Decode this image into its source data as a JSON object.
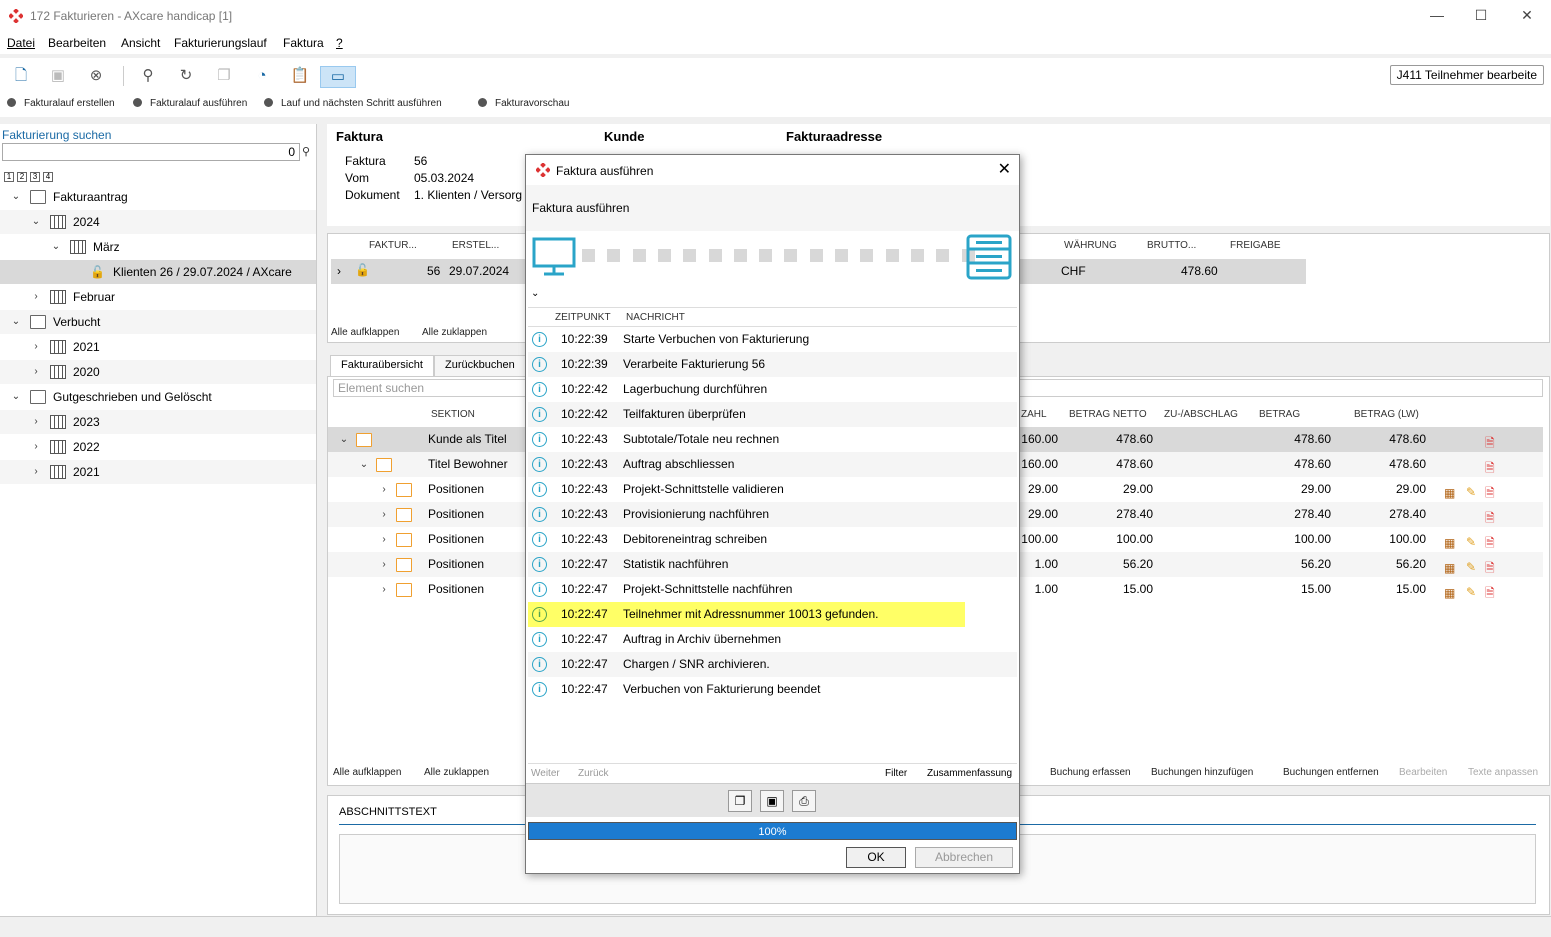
{
  "window": {
    "title": "172 Fakturieren - AXcare handicap [1]",
    "min": "—",
    "max": "☐",
    "close": "✕"
  },
  "menu": [
    "Datei",
    "Bearbeiten",
    "Ansicht",
    "Fakturierungslauf",
    "Faktura",
    "?"
  ],
  "top_button": "J411 Teilnehmer bearbeite",
  "actions": [
    "Fakturalauf erstellen",
    "Fakturalauf ausführen",
    "Lauf und nächsten Schritt ausführen",
    "Fakturavorschau"
  ],
  "left": {
    "search_label": "Fakturierung suchen",
    "search_value": "0",
    "levels": [
      "1",
      "2",
      "3",
      "4"
    ],
    "tree": [
      {
        "label": "Fakturaantrag",
        "chev": "⌄",
        "icon": "folder"
      },
      {
        "label": "2024",
        "chev": "⌄",
        "icon": "cal"
      },
      {
        "label": "März",
        "chev": "⌄",
        "icon": "cal"
      },
      {
        "label": "Klienten 26 / 29.07.2024 / AXcare",
        "chev": "",
        "icon": "lock"
      },
      {
        "label": "Februar",
        "chev": "›",
        "icon": "cal"
      },
      {
        "label": "Verbucht",
        "chev": "⌄",
        "icon": "folder"
      },
      {
        "label": "2021",
        "chev": "›",
        "icon": "cal"
      },
      {
        "label": "2020",
        "chev": "›",
        "icon": "cal"
      },
      {
        "label": "Gutgeschrieben und Gelöscht",
        "chev": "⌄",
        "icon": "folder"
      },
      {
        "label": "2023",
        "chev": "›",
        "icon": "cal"
      },
      {
        "label": "2022",
        "chev": "›",
        "icon": "cal"
      },
      {
        "label": "2021",
        "chev": "›",
        "icon": "cal"
      }
    ]
  },
  "header": {
    "faktura": "Faktura",
    "kunde": "Kunde",
    "adresse": "Fakturaadresse",
    "faktura_lbl": "Faktura",
    "faktura_val": "56",
    "vom_lbl": "Vom",
    "vom_val": "05.03.2024",
    "dok_lbl": "Dokument",
    "dok_val": "1. Klienten / Versorg"
  },
  "grid1": {
    "cols": [
      "FAKTUR...",
      "ERSTEL...",
      "WÄHRUNG",
      "BRUTTO...",
      "FREIGABE"
    ],
    "row": {
      "nr": "56",
      "date": "29.07.2024",
      "cur": "CHF",
      "brutto": "478.60"
    },
    "expand": "Alle aufklappen",
    "collapse": "Alle zuklappen"
  },
  "tabs": [
    "Fakturaübersicht",
    "Zurückbuchen"
  ],
  "grid2": {
    "search_placeholder": "Element suchen",
    "cols": [
      "SEKTION",
      "ZAHL",
      "BETRAG NETTO",
      "ZU-/ABSCHLAG",
      "BETRAG",
      "BETRAG (LW)"
    ],
    "rows": [
      {
        "label": "Kunde als Titel",
        "zahl": "160.00",
        "netto": "478.60",
        "betrag": "478.60",
        "lw": "478.60"
      },
      {
        "label": "Titel Bewohner",
        "zahl": "160.00",
        "netto": "478.60",
        "betrag": "478.60",
        "lw": "478.60"
      },
      {
        "label": "Positionen",
        "zahl": "29.00",
        "netto": "29.00",
        "betrag": "29.00",
        "lw": "29.00"
      },
      {
        "label": "Positionen",
        "zahl": "29.00",
        "netto": "278.40",
        "betrag": "278.40",
        "lw": "278.40"
      },
      {
        "label": "Positionen",
        "zahl": "100.00",
        "netto": "100.00",
        "betrag": "100.00",
        "lw": "100.00"
      },
      {
        "label": "Positionen",
        "zahl": "1.00",
        "netto": "56.20",
        "betrag": "56.20",
        "lw": "56.20"
      },
      {
        "label": "Positionen",
        "zahl": "1.00",
        "netto": "15.00",
        "betrag": "15.00",
        "lw": "15.00"
      }
    ],
    "footer": [
      "Alle aufklappen",
      "Alle zuklappen",
      "Buchung erfassen",
      "Buchungen hinzufügen",
      "Buchungen entfernen",
      "Bearbeiten",
      "Texte anpassen"
    ]
  },
  "abschnitt": "ABSCHNITTSTEXT",
  "dialog": {
    "title": "Faktura ausführen",
    "subtitle": "Faktura ausführen",
    "cols": [
      "ZEITPUNKT",
      "NACHRICHT"
    ],
    "log": [
      {
        "t": "10:22:39",
        "m": "Starte Verbuchen von Fakturierung"
      },
      {
        "t": "10:22:39",
        "m": "Verarbeite Fakturierung 56"
      },
      {
        "t": "10:22:42",
        "m": "Lagerbuchung durchführen"
      },
      {
        "t": "10:22:42",
        "m": "Teilfakturen überprüfen"
      },
      {
        "t": "10:22:43",
        "m": "Subtotale/Totale neu rechnen"
      },
      {
        "t": "10:22:43",
        "m": "Auftrag abschliessen"
      },
      {
        "t": "10:22:43",
        "m": "Projekt-Schnittstelle validieren"
      },
      {
        "t": "10:22:43",
        "m": "Provisionierung nachführen"
      },
      {
        "t": "10:22:43",
        "m": "Debitoreneintrag schreiben"
      },
      {
        "t": "10:22:47",
        "m": "Statistik nachführen"
      },
      {
        "t": "10:22:47",
        "m": "Projekt-Schnittstelle nachführen"
      },
      {
        "t": "10:22:47",
        "m": "Teilnehmer mit Adressnummer 10013 gefunden."
      },
      {
        "t": "10:22:47",
        "m": "Auftrag in Archiv übernehmen"
      },
      {
        "t": "10:22:47",
        "m": "Chargen / SNR archivieren."
      },
      {
        "t": "10:22:47",
        "m": "Verbuchen von Fakturierung beendet"
      }
    ],
    "weiter": "Weiter",
    "zurueck": "Zurück",
    "filter": "Filter",
    "summary": "Zusammenfassung",
    "progress": "100%",
    "ok": "OK",
    "cancel": "Abbrechen"
  }
}
